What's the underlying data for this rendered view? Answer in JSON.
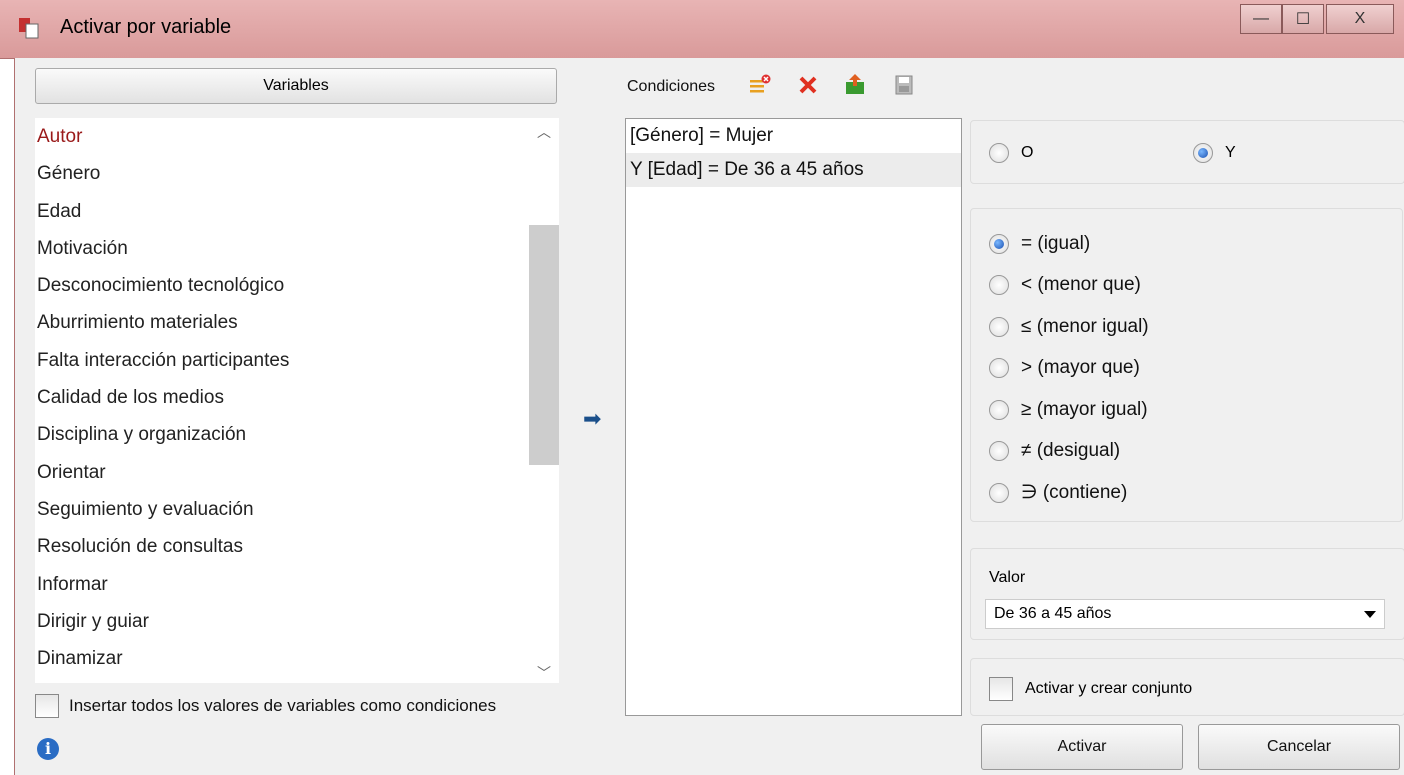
{
  "window": {
    "title": "Activar por variable",
    "icon": "app-icon",
    "controls": {
      "minimize": "—",
      "maximize": "☐",
      "close": "X"
    }
  },
  "variables": {
    "button_label": "Variables",
    "selected_index": 0,
    "items": [
      "Autor",
      "Género",
      "Edad",
      "Motivación",
      "Desconocimiento tecnológico",
      "Aburrimiento materiales",
      "Falta interacción participantes",
      "Calidad de los medios",
      "Disciplina y organización",
      "Orientar",
      "Seguimiento y evaluación",
      "Resolución de consultas",
      "Informar",
      "Dirigir y guiar",
      "Dinamizar"
    ],
    "insert_all_label": "Insertar todos los valores de variables como condiciones",
    "insert_all_checked": false
  },
  "conditions": {
    "label": "Condiciones",
    "toolbar_icons": [
      "clear-list-icon",
      "delete-icon",
      "export-icon",
      "save-icon"
    ],
    "items": [
      {
        "text": "[Género] = Mujer",
        "selected": false
      },
      {
        "text": "Y [Edad] = De 36 a 45 años",
        "selected": true
      }
    ]
  },
  "logic": {
    "o_label": "O",
    "y_label": "Y",
    "selected": "Y"
  },
  "operators": {
    "selected_index": 0,
    "items": [
      "= (igual)",
      "< (menor que)",
      "≤ (menor igual)",
      "> (mayor que)",
      "≥ (mayor igual)",
      "≠ (desigual)",
      "∋  (contiene)"
    ]
  },
  "valor": {
    "label": "Valor",
    "selected": "De 36 a 45 años"
  },
  "create_set": {
    "label": "Activar y crear conjunto",
    "checked": false
  },
  "buttons": {
    "activar": "Activar",
    "cancelar": "Cancelar"
  },
  "colors": {
    "titlebar": "#d99a9a",
    "selected_variable": "#9a1a1a",
    "arrow": "#1a4f8a",
    "radio_selected": "#1a4fb0"
  }
}
